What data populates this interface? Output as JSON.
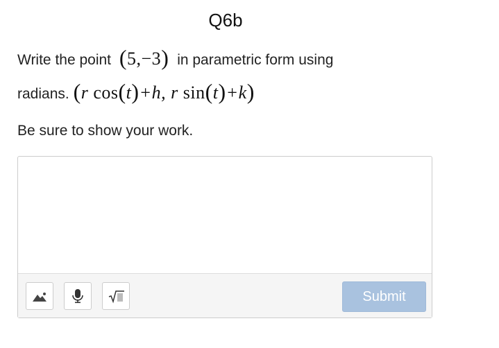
{
  "question": {
    "title": "Q6b",
    "line1_prefix": "Write the point",
    "point": "5,−3",
    "line1_suffix": "in parametric form using",
    "line2_prefix": "radians.",
    "formula_r1": "r",
    "formula_cos": "cos",
    "formula_t1": "t",
    "formula_plus_h": "+h, ",
    "formula_r2": "r",
    "formula_sin": "sin",
    "formula_t2": "t",
    "formula_plus_k": "+k",
    "note": "Be sure to show your work."
  },
  "answer": {
    "value": "",
    "placeholder": ""
  },
  "toolbar": {
    "image_icon": "image-icon",
    "mic_icon": "microphone-icon",
    "math_icon": "square-root-icon",
    "submit_label": "Submit"
  },
  "colors": {
    "submit_bg": "#a9c2df",
    "toolbar_bg": "#f5f5f5",
    "border": "#cccccc"
  }
}
